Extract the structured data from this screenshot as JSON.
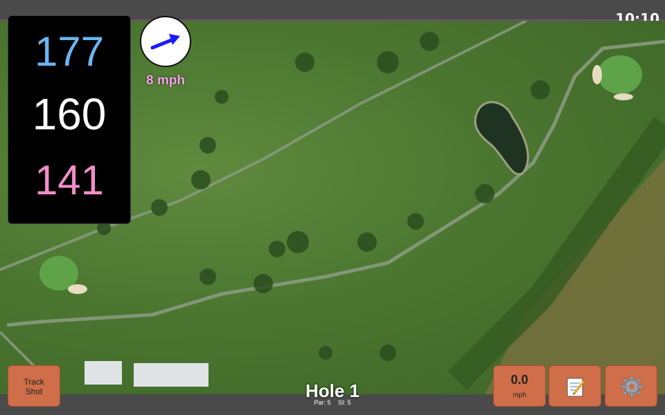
{
  "status": {
    "time": "10:10"
  },
  "yardages": {
    "back": "177",
    "center": "160",
    "front": "141"
  },
  "wind": {
    "speed": "8 mph"
  },
  "hole": {
    "title": "Hole 1",
    "par": "Par: 5",
    "si": "SI: 5"
  },
  "buttons": {
    "track_shot_line1": "Track",
    "track_shot_line2": "Shot",
    "speed_value": "0.0",
    "speed_unit": "mph"
  },
  "icons": {
    "wind_arrow": "arrow-icon",
    "notes": "notepad-icon",
    "settings": "gear-icon"
  },
  "colors": {
    "back_yardage": "#6ab6f2",
    "center_yardage": "#ffffff",
    "front_yardage": "#f28ec9",
    "button": "#cf6e48",
    "wind_arrow": "#1a1aff"
  }
}
